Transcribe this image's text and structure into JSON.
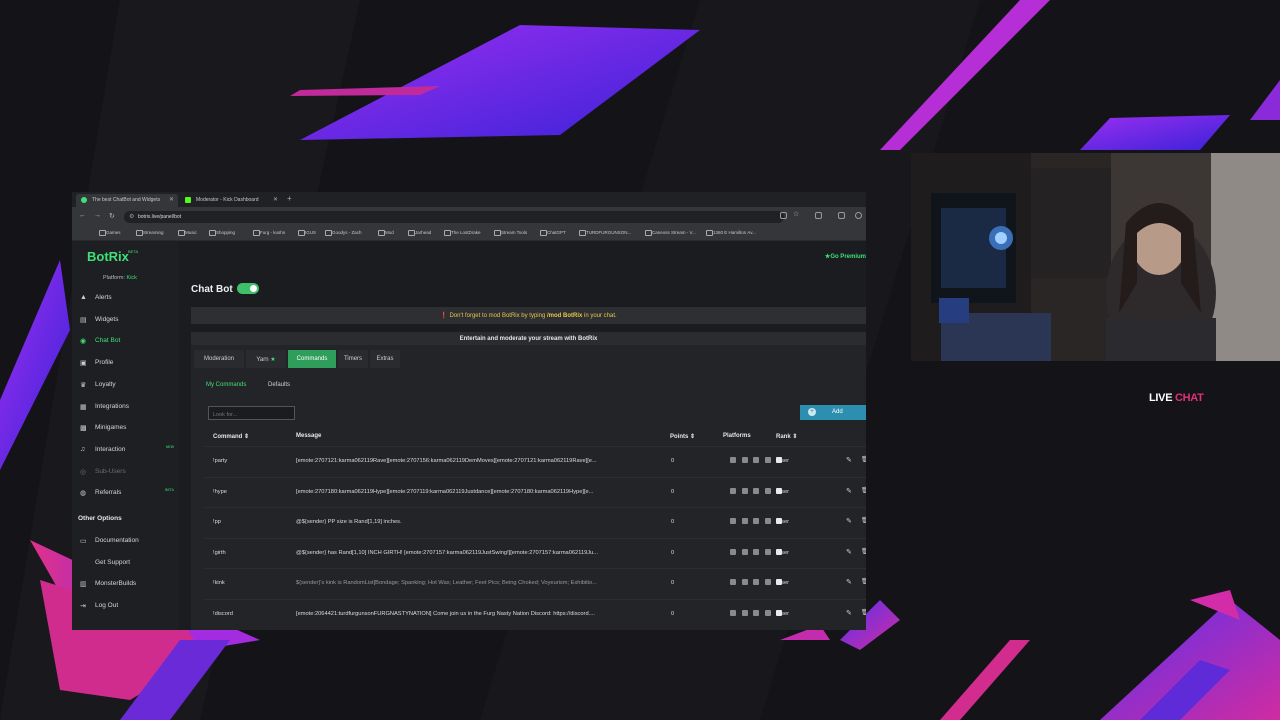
{
  "browser": {
    "tabs": [
      {
        "title": "The best ChatBot and Widgets",
        "active": true
      },
      {
        "title": "Moderator - Kick Dashboard",
        "active": false
      }
    ],
    "url": "botrix.live/panel/bot",
    "bookmarks": [
      "Games",
      "Streaming",
      "Music",
      "Shopping",
      "Furg - kushn",
      "IGUS",
      "Goodys - Zach",
      "Mod",
      "Jarhead",
      "The LostDrake",
      "Stream Tools",
      "ChatGPT",
      "TURDFURGUNSON...",
      "Caneoss Stream - V...",
      "1360 E Hamilton Av..."
    ]
  },
  "sidebar": {
    "logo": "BotRix",
    "logo_badge": "BETA",
    "platform_label": "Platform:",
    "platform_value": "Kick",
    "items": [
      {
        "label": "Alerts",
        "icon": "warning-icon"
      },
      {
        "label": "Widgets",
        "icon": "widgets-icon"
      },
      {
        "label": "Chat Bot",
        "icon": "robot-icon",
        "active": true
      },
      {
        "label": "Profile",
        "icon": "profile-icon"
      },
      {
        "label": "Loyalty",
        "icon": "loyalty-icon"
      },
      {
        "label": "Integrations",
        "icon": "integrations-icon"
      },
      {
        "label": "Minigames",
        "icon": "minigames-icon"
      },
      {
        "label": "Interaction",
        "icon": "music-icon",
        "badge": "NEW"
      },
      {
        "label": "Sub-Users",
        "icon": "users-icon",
        "dim": true
      },
      {
        "label": "Referrals",
        "icon": "referrals-icon",
        "badge": "BETA"
      }
    ],
    "other_heading": "Other Options",
    "other_items": [
      "Documentation",
      "Get Support",
      "MonsterBuilds",
      "Log Out"
    ]
  },
  "main": {
    "premium": "Go Premium",
    "title": "Chat Bot",
    "toggle_on": true,
    "notice_prefix": "Don't forget to mod BotRix by typing",
    "notice_command": "/mod BotRix",
    "notice_suffix": "in your chat.",
    "card_heading": "Entertain and moderate your stream with BotRix",
    "tabs": [
      "Moderation",
      "Yarn",
      "Commands",
      "Timers",
      "Extras"
    ],
    "active_tab": "Commands",
    "subtabs": [
      "My Commands",
      "Defaults"
    ],
    "search_placeholder": "Look for...",
    "add_label": "Add",
    "columns": {
      "command": "Command",
      "message": "Message",
      "points": "Points",
      "platforms": "Platforms",
      "rank": "Rank"
    },
    "rows": [
      {
        "command": "!party",
        "message": "[emote:2707121:karma062119Rave][emote:2707156:karma062119DemMoves][emote:2707121:karma062119Rave][e...",
        "points": "0",
        "rank": "User"
      },
      {
        "command": "!hype",
        "message": "[emote:2707180:karma062119Hype][emote:2707119:karma062119Justdance][emote:2707180:karma062119Hype][e...",
        "points": "0",
        "rank": "User"
      },
      {
        "command": "!pp",
        "message": "@${sender} PP size is Rand[1,19] inches.",
        "points": "0",
        "rank": "User"
      },
      {
        "command": "!girth",
        "message": "@${sender} has Rand[1,10] INCH GIRTH! [emote:2707157:karma062119JustSwing!][emote:2707157:karma062119Ju...",
        "points": "0",
        "rank": "User"
      },
      {
        "command": "!kink",
        "message": "${sender}'s kink is RandomList[Bondage; Spanking; Hot Wax; Leather; Feet Pics; Being Choked; Voyeurism; Exhibitio...",
        "points": "0",
        "rank": "User",
        "dim": true
      },
      {
        "command": "!discord",
        "message": "[emote:2064421:turdfurgunsonFURGNASTYNATION] Come join us in the Furg Nasty Nation Discord: https://discord....",
        "points": "0",
        "rank": "User"
      }
    ]
  },
  "overlay": {
    "live": "LIVE",
    "chat": "CHAT"
  },
  "colors": {
    "accent": "#3fe07a",
    "notice": "#e6c64a",
    "add_button": "#2c8fb0",
    "neon_purple": "#7a2cf0",
    "neon_pink": "#e0307a"
  }
}
